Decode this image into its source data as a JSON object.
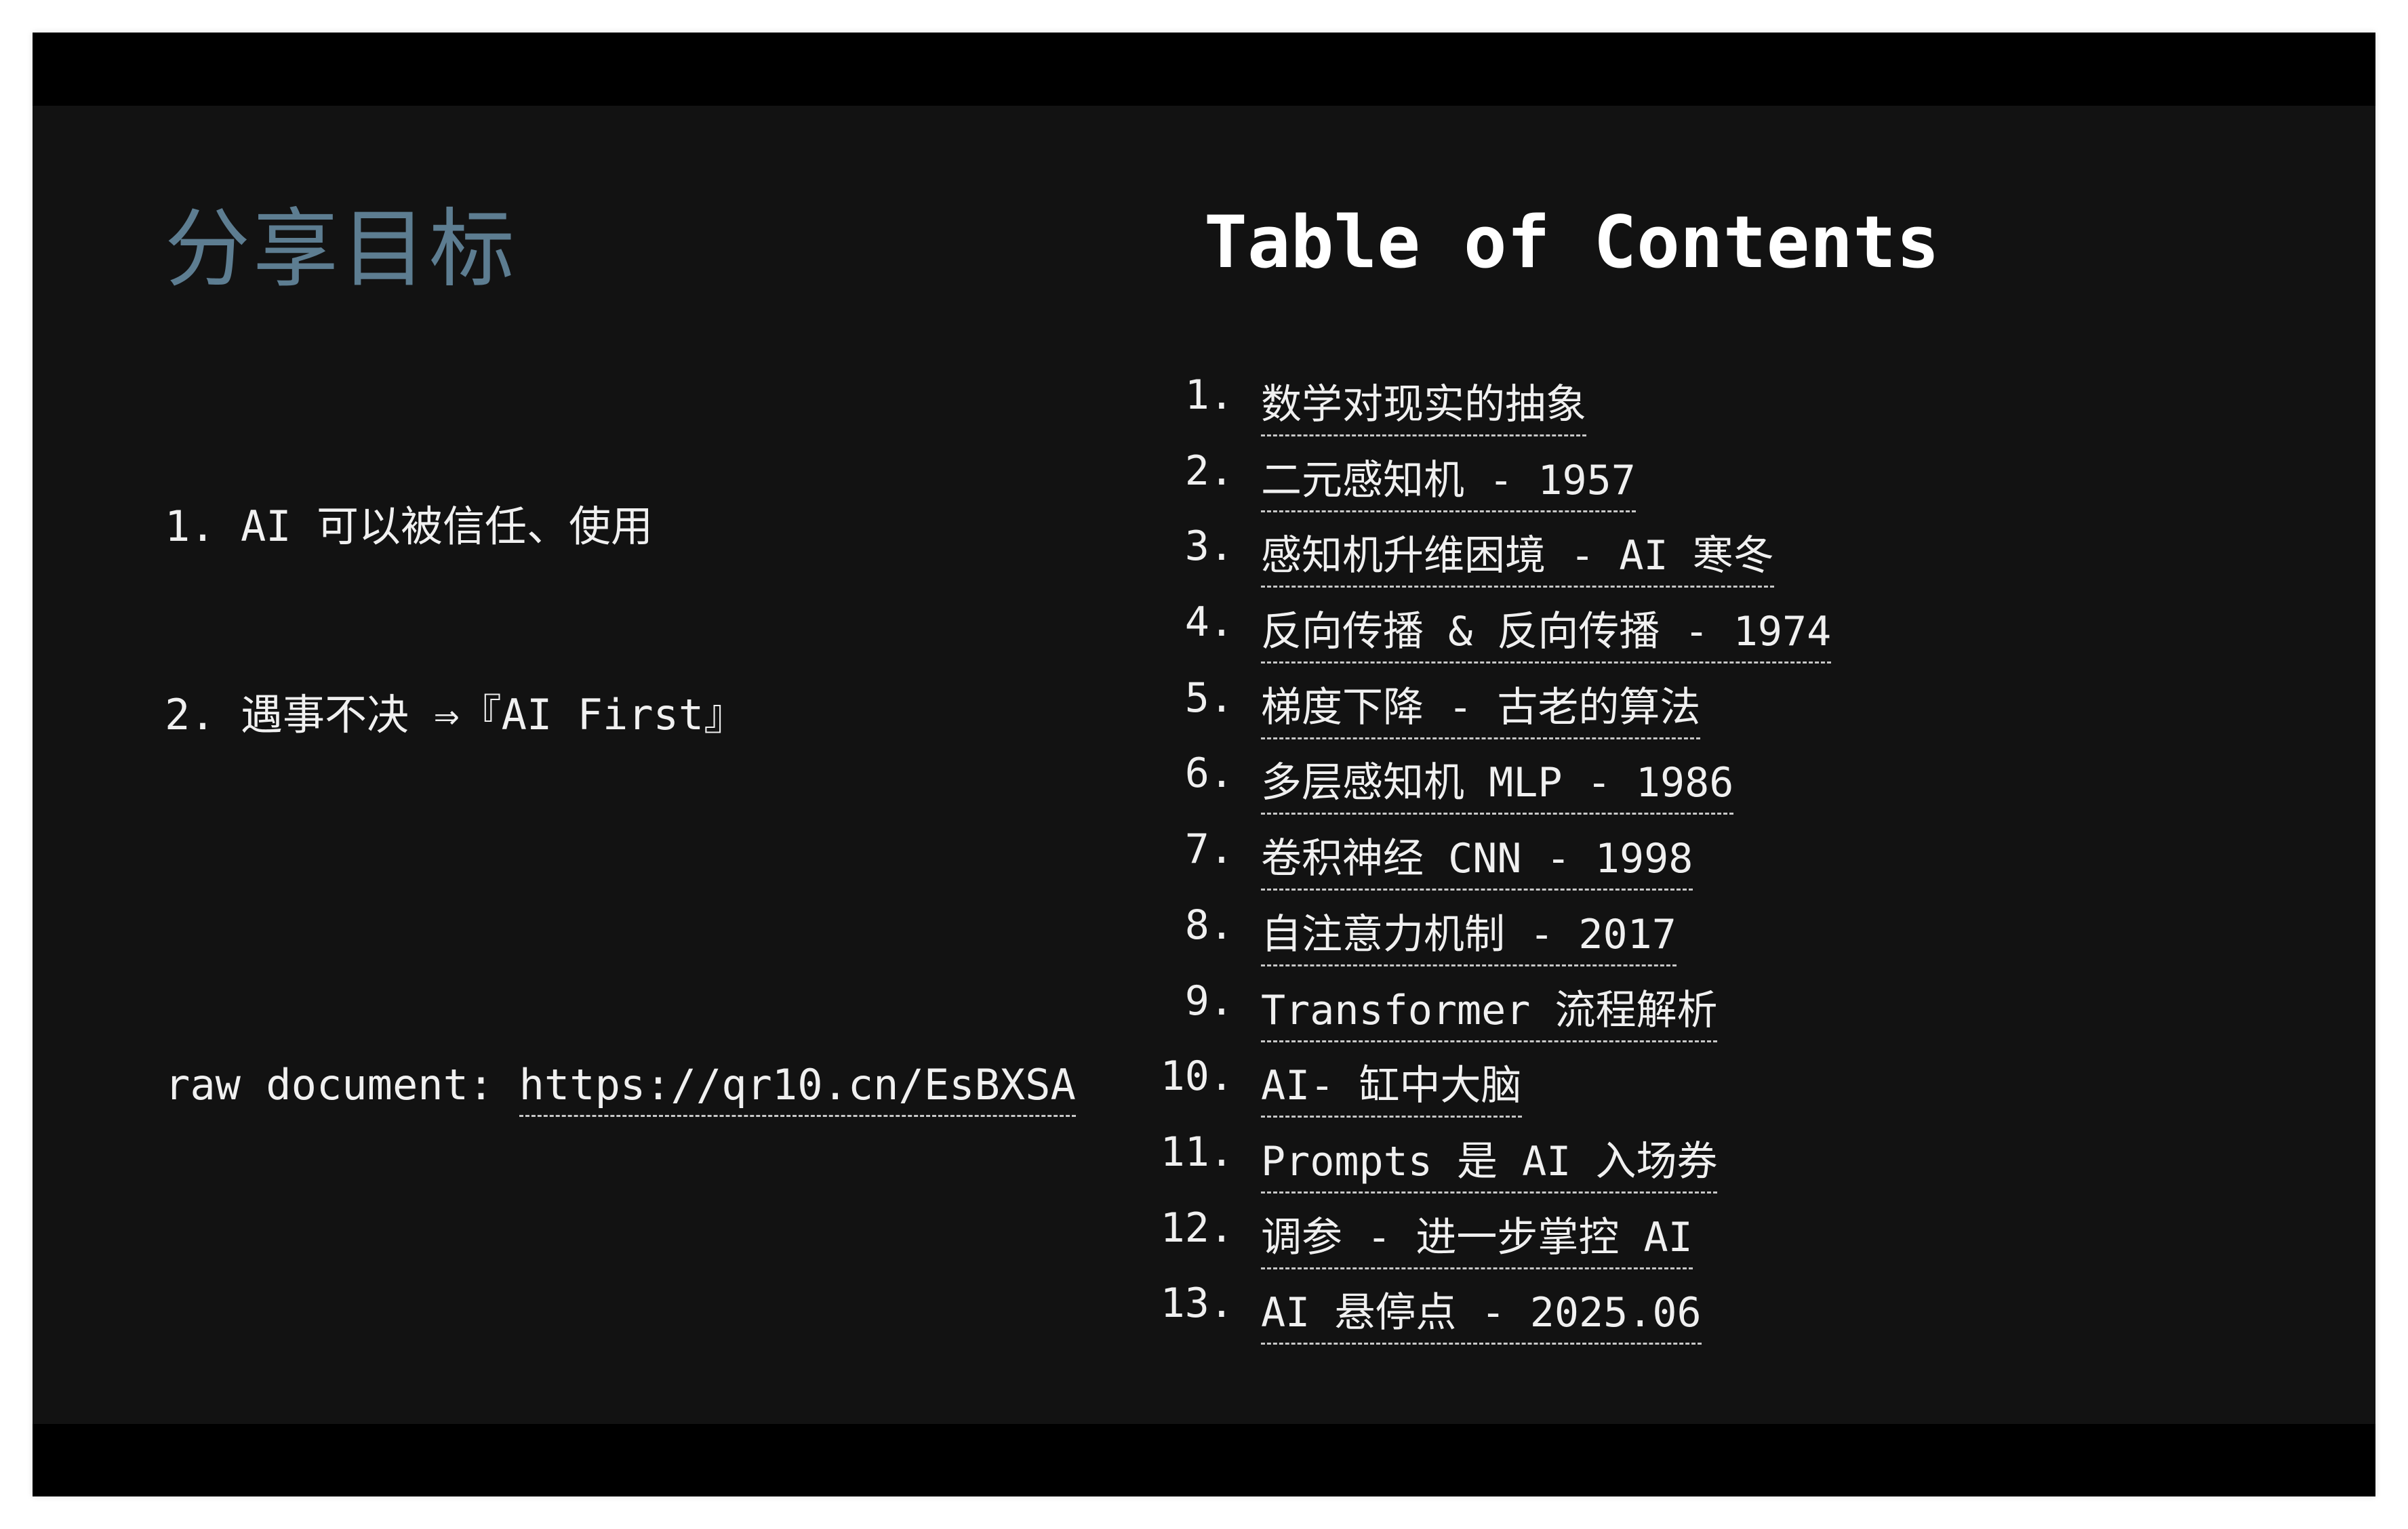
{
  "slide": {
    "heading": "分享目标",
    "goals": [
      "1. AI 可以被信任、使用",
      "2. 遇事不决 ⇒『AI First』"
    ],
    "raw_document": {
      "label": "raw document: ",
      "url": "https://qr10.cn/EsBXSA"
    },
    "toc_title": "Table of Contents",
    "toc": [
      {
        "num": "1.",
        "text": "数学对现实的抽象"
      },
      {
        "num": "2.",
        "text": "二元感知机 - 1957"
      },
      {
        "num": "3.",
        "text": "感知机升维困境 - AI 寒冬"
      },
      {
        "num": "4.",
        "text": "反向传播 & 反向传播 - 1974"
      },
      {
        "num": "5.",
        "text": "梯度下降 - 古老的算法"
      },
      {
        "num": "6.",
        "text": "多层感知机 MLP - 1986"
      },
      {
        "num": "7.",
        "text": "卷积神经 CNN - 1998"
      },
      {
        "num": "8.",
        "text": "自注意力机制 - 2017"
      },
      {
        "num": "9.",
        "text": "Transformer 流程解析"
      },
      {
        "num": "10.",
        "text": "AI- 缸中大脑"
      },
      {
        "num": "11.",
        "text": "Prompts 是 AI 入场券"
      },
      {
        "num": "12.",
        "text": "调参 - 进一步掌控 AI"
      },
      {
        "num": "13.",
        "text": "AI 悬停点 - 2025.06"
      }
    ]
  },
  "colors": {
    "slide_background": "#121212",
    "letterbox": "#000000",
    "heading": "#5d7d91",
    "text": "#f0f0f0"
  }
}
